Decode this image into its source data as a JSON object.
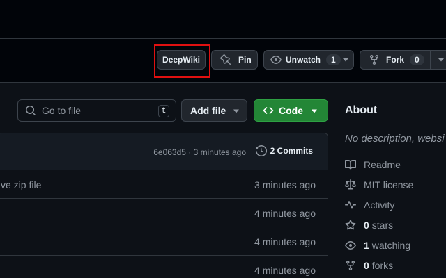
{
  "header": {
    "deepwiki_label": "DeepWiki",
    "pin_label": "Pin",
    "unwatch_label": "Unwatch",
    "unwatch_count": "1",
    "fork_label": "Fork",
    "fork_count": "0"
  },
  "toolbar": {
    "search_placeholder": "Go to file",
    "search_shortcut": "t",
    "add_file_label": "Add file",
    "code_label": "Code"
  },
  "commit_bar": {
    "meta": "6e063d5 · 3 minutes ago",
    "commits_label": "2 Commits"
  },
  "files": [
    {
      "message": "ve zip file",
      "time": "3 minutes ago"
    },
    {
      "message": "",
      "time": "4 minutes ago"
    },
    {
      "message": "",
      "time": "4 minutes ago"
    },
    {
      "message": "",
      "time": "4 minutes ago"
    }
  ],
  "about": {
    "title": "About",
    "description": "No description, websi",
    "readme": "Readme",
    "license": "MIT license",
    "activity": "Activity",
    "stars_count": "0",
    "stars_label": "stars",
    "watching_count": "1",
    "watching_label": "watching",
    "forks_count": "0",
    "forks_label": "forks"
  },
  "colors": {
    "background": "#0d1117",
    "code_button": "#238636",
    "highlight_box": "#e01010"
  }
}
